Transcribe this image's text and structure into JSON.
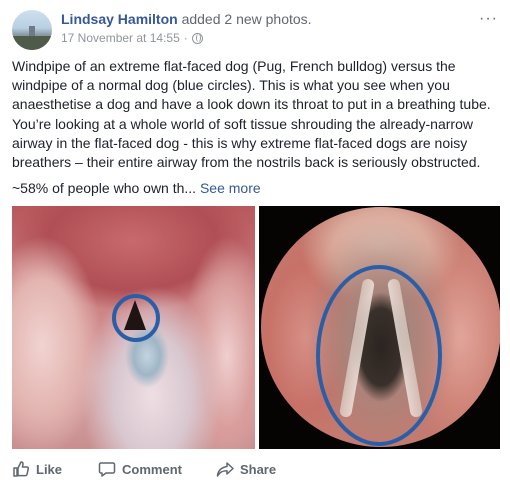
{
  "post": {
    "author": "Lindsay Hamilton",
    "action": "added 2 new photos.",
    "timestamp": "17 November at 14:55",
    "separator": "·",
    "text": "Windpipe of an extreme flat-faced dog (Pug, French bulldog) versus the windpipe of a normal dog (blue circles). This is what you see when you anaesthetise a dog and have a look down its throat to put in a breathing tube. You’re looking at a whole world of soft tissue shrouding the already-narrow airway in the flat-faced dog - this is why extreme flat-faced dogs are noisy breathers – their entire airway from the nostrils back is seriously obstructed.",
    "excerpt": "~58% of people who own th...",
    "see_more": "See more",
    "more_menu": "···"
  },
  "actions": {
    "like": "Like",
    "comment": "Comment",
    "share": "Share"
  },
  "colors": {
    "author_link": "#365899",
    "meta_grey": "#90949c",
    "annotation_circle": "#2a5fa8"
  },
  "icons": [
    "globe-icon",
    "more-icon",
    "like-icon",
    "comment-icon",
    "share-icon"
  ]
}
